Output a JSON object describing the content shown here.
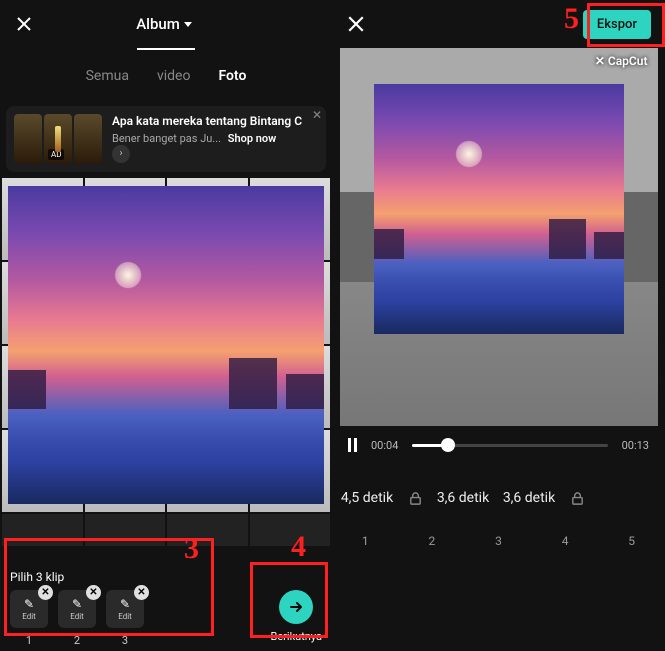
{
  "left": {
    "header_title": "Album",
    "tabs": {
      "all": "Semua",
      "video": "video",
      "photo": "Foto"
    },
    "ad": {
      "badge": "AD",
      "title": "Apa kata mereka tentang Bintang C",
      "subtitle": "Bener banget pas Ju...",
      "shop": "Shop now"
    },
    "selection": {
      "label": "Pilih 3 klip",
      "edit": "Edit",
      "clips": [
        "1",
        "2",
        "3"
      ]
    },
    "next": "Berikutnya"
  },
  "right": {
    "export": "Ekspor",
    "watermark": "✕ CapCut",
    "player": {
      "current": "00:04",
      "total": "00:13",
      "progress_pct": 18
    },
    "durations": [
      "4,5 detik",
      "3,6 detik",
      "3,6 detik"
    ],
    "timeline_nums": [
      "1",
      "2",
      "3",
      "4",
      "5"
    ]
  },
  "annotations": {
    "n3": "3",
    "n4": "4",
    "n5": "5"
  },
  "colors": {
    "accent": "#2dd4bf",
    "annotation": "#ff2020"
  }
}
